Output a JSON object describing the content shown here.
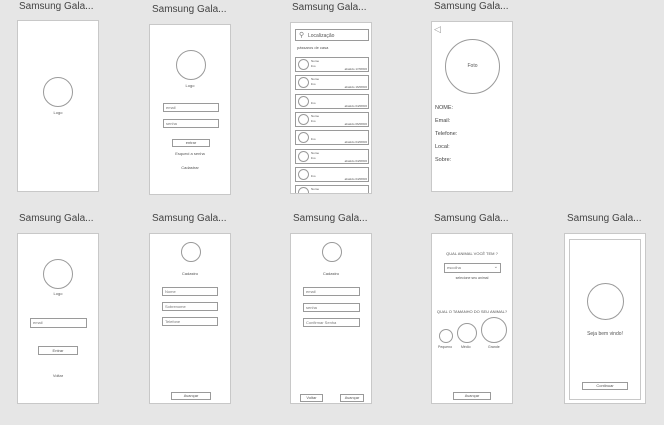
{
  "screens": {
    "s1": {
      "title": "Samsung Gala...",
      "logo": "Logo"
    },
    "s2": {
      "title": "Samsung Gala...",
      "logo": "Logo",
      "email": "email",
      "password": "senha",
      "enter": "entrar",
      "forgot": "Esqueci a senha",
      "register": "Cadastrar"
    },
    "s3": {
      "title": "Samsung Gala...",
      "location": "Localização",
      "nearby": "pássaros de casa",
      "items": [
        {
          "name": "Nome",
          "sub": "lixo",
          "date": "abatido 17/08/06"
        },
        {
          "name": "Nome",
          "sub": "lixo",
          "date": "abatido 16/08/06"
        },
        {
          "name": "",
          "sub": "lixo",
          "date": "abatido 04/08/06"
        },
        {
          "name": "Nome",
          "sub": "lixo",
          "date": "abatido 06/08/06"
        },
        {
          "name": "",
          "sub": "lixo",
          "date": "abatido 04/08/06"
        },
        {
          "name": "Nome",
          "sub": "lixo",
          "date": "abatido 04/08/06"
        },
        {
          "name": "",
          "sub": "lixo",
          "date": "abatido 04/08/06"
        },
        {
          "name": "Nome",
          "sub": "lixo",
          "date": ""
        }
      ]
    },
    "s4": {
      "title": "Samsung Gala...",
      "photo": "Foto",
      "back": "◁",
      "fields": [
        "NOME:",
        "Email:",
        "Telefone:",
        "Local:",
        "Sobre:"
      ]
    },
    "s5": {
      "title": "Samsung Gala...",
      "logo": "Logo",
      "email": "email",
      "enter": "Entrar",
      "back": "Voltar"
    },
    "s6": {
      "title": "Samsung Gala...",
      "caption": "Cadastro",
      "fields": [
        "Nome",
        "Sobrenome",
        "Telefone"
      ],
      "next": "Avançar"
    },
    "s7": {
      "title": "Samsung Gala...",
      "caption": "Cadastro",
      "fields": [
        "email",
        "senha",
        "Confirmar Senha"
      ],
      "back": "Voltar",
      "next": "Avançar"
    },
    "s8": {
      "title": "Samsung Gala...",
      "q1": "QUAL ANIMAL VOCÊ TEM ?",
      "select": "escolha",
      "hint": "selecione seu animal",
      "q2": "QUAL O TAMANHO DO SEU ANIMAL?",
      "sizes": [
        "Pequeno",
        "Médio",
        "Grande"
      ],
      "next": "Avançar"
    },
    "s9": {
      "title": "Samsung Gala...",
      "welcome": "Seja bem vindo!",
      "continue": "Continuar"
    }
  }
}
